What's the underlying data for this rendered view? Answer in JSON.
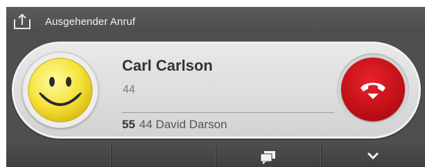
{
  "window": {
    "title": "Ausgehender Anruf",
    "title_icon": "upload-icon"
  },
  "call": {
    "caller_name": "Carl Carlson",
    "caller_number": "44",
    "avatar_icon": "smiley-icon",
    "line_extension": "55",
    "line_label": "44 David Darson",
    "hangup_icon": "phone-hangup-icon"
  },
  "toolbar": {
    "buttons": [
      {
        "icon": ""
      },
      {
        "icon": ""
      },
      {
        "icon": "chat-icon"
      },
      {
        "icon": "chevron-down-icon"
      }
    ]
  },
  "colors": {
    "hangup": "#d3141c",
    "titlebar": "#4f4f4f",
    "card": "#dcdcdc"
  }
}
